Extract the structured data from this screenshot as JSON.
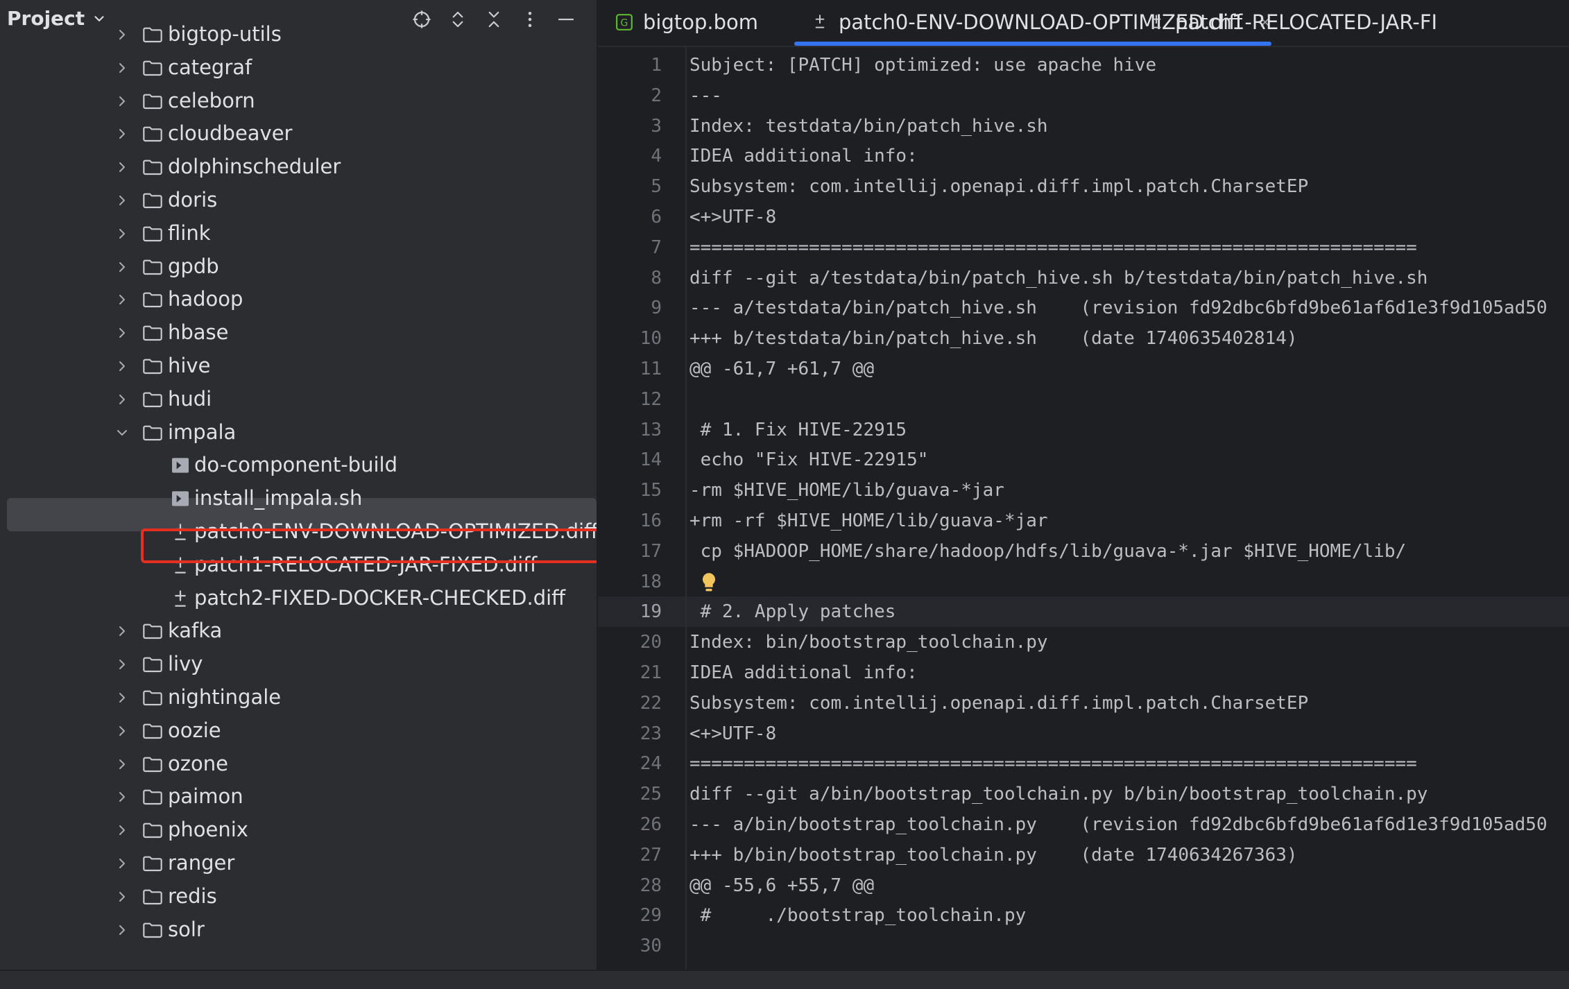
{
  "project_panel": {
    "title": "Project",
    "tree": [
      {
        "label": "bigtop-utils",
        "type": "folder",
        "expanded": false
      },
      {
        "label": "categraf",
        "type": "folder",
        "expanded": false
      },
      {
        "label": "celeborn",
        "type": "folder",
        "expanded": false
      },
      {
        "label": "cloudbeaver",
        "type": "folder",
        "expanded": false
      },
      {
        "label": "dolphinscheduler",
        "type": "folder",
        "expanded": false
      },
      {
        "label": "doris",
        "type": "folder",
        "expanded": false
      },
      {
        "label": "flink",
        "type": "folder",
        "expanded": false
      },
      {
        "label": "gpdb",
        "type": "folder",
        "expanded": false
      },
      {
        "label": "hadoop",
        "type": "folder",
        "expanded": false
      },
      {
        "label": "hbase",
        "type": "folder",
        "expanded": false
      },
      {
        "label": "hive",
        "type": "folder",
        "expanded": false
      },
      {
        "label": "hudi",
        "type": "folder",
        "expanded": false
      },
      {
        "label": "impala",
        "type": "folder",
        "expanded": true
      },
      {
        "label": "do-component-build",
        "type": "script"
      },
      {
        "label": "install_impala.sh",
        "type": "script"
      },
      {
        "label": "patch0-ENV-DOWNLOAD-OPTIMIZED.diff",
        "type": "diff",
        "selected": true
      },
      {
        "label": "patch1-RELOCATED-JAR-FIXED.diff",
        "type": "diff"
      },
      {
        "label": "patch2-FIXED-DOCKER-CHECKED.diff",
        "type": "diff"
      },
      {
        "label": "kafka",
        "type": "folder",
        "expanded": false
      },
      {
        "label": "livy",
        "type": "folder",
        "expanded": false
      },
      {
        "label": "nightingale",
        "type": "folder",
        "expanded": false
      },
      {
        "label": "oozie",
        "type": "folder",
        "expanded": false
      },
      {
        "label": "ozone",
        "type": "folder",
        "expanded": false
      },
      {
        "label": "paimon",
        "type": "folder",
        "expanded": false
      },
      {
        "label": "phoenix",
        "type": "folder",
        "expanded": false
      },
      {
        "label": "ranger",
        "type": "folder",
        "expanded": false
      },
      {
        "label": "redis",
        "type": "folder",
        "expanded": false
      },
      {
        "label": "solr",
        "type": "folder",
        "expanded": false
      }
    ]
  },
  "tabs": [
    {
      "label": "bigtop.bom",
      "icon": "gradle-file-icon"
    },
    {
      "label": "patch0-ENV-DOWNLOAD-OPTIMIZED.diff",
      "icon": "diff-file-icon",
      "active": true
    },
    {
      "label": "patch1-RELOCATED-JAR-FI",
      "icon": "diff-file-icon"
    }
  ],
  "editor": {
    "current_line": 19,
    "lines": [
      {
        "n": "1",
        "text": "Subject: [PATCH] optimized: use apache hive"
      },
      {
        "n": "2",
        "text": "---"
      },
      {
        "n": "3",
        "text": "Index: testdata/bin/patch_hive.sh"
      },
      {
        "n": "4",
        "text": "IDEA additional info:"
      },
      {
        "n": "5",
        "text": "Subsystem: com.intellij.openapi.diff.impl.patch.CharsetEP"
      },
      {
        "n": "6",
        "text": "<+>UTF-8"
      },
      {
        "n": "7",
        "text": "==================================================================="
      },
      {
        "n": "8",
        "text": "diff --git a/testdata/bin/patch_hive.sh b/testdata/bin/patch_hive.sh"
      },
      {
        "n": "9",
        "text": "--- a/testdata/bin/patch_hive.sh    (revision fd92dbc6bfd9be61af6d1e3f9d105ad50"
      },
      {
        "n": "10",
        "text": "+++ b/testdata/bin/patch_hive.sh    (date 1740635402814)"
      },
      {
        "n": "11",
        "text": "@@ -61,7 +61,7 @@"
      },
      {
        "n": "12",
        "text": ""
      },
      {
        "n": "13",
        "text": " # 1. Fix HIVE-22915"
      },
      {
        "n": "14",
        "text": " echo \"Fix HIVE-22915\""
      },
      {
        "n": "15",
        "text": "-rm $HIVE_HOME/lib/guava-*jar"
      },
      {
        "n": "16",
        "text": "+rm -rf $HIVE_HOME/lib/guava-*jar"
      },
      {
        "n": "17",
        "text": " cp $HADOOP_HOME/share/hadoop/hdfs/lib/guava-*.jar $HIVE_HOME/lib/"
      },
      {
        "n": "18",
        "text": ""
      },
      {
        "n": "19",
        "text": " # 2. Apply patches"
      },
      {
        "n": "20",
        "text": "Index: bin/bootstrap_toolchain.py"
      },
      {
        "n": "21",
        "text": "IDEA additional info:"
      },
      {
        "n": "22",
        "text": "Subsystem: com.intellij.openapi.diff.impl.patch.CharsetEP"
      },
      {
        "n": "23",
        "text": "<+>UTF-8"
      },
      {
        "n": "24",
        "text": "==================================================================="
      },
      {
        "n": "25",
        "text": "diff --git a/bin/bootstrap_toolchain.py b/bin/bootstrap_toolchain.py"
      },
      {
        "n": "26",
        "text": "--- a/bin/bootstrap_toolchain.py    (revision fd92dbc6bfd9be61af6d1e3f9d105ad50"
      },
      {
        "n": "27",
        "text": "+++ b/bin/bootstrap_toolchain.py    (date 1740634267363)"
      },
      {
        "n": "28",
        "text": "@@ -55,6 +55,7 @@"
      },
      {
        "n": "29",
        "text": " #     ./bootstrap_toolchain.py"
      },
      {
        "n": "30",
        "text": ""
      }
    ]
  },
  "colors": {
    "accent": "#3574f0",
    "highlight_box": "#e5301f",
    "panel_bg": "#2b2d30",
    "editor_bg": "#1e1f22"
  },
  "icons": [
    "target-icon",
    "expand-collapse-icon",
    "collapse-all-icon",
    "more-options-icon",
    "minimize-icon",
    "chevron-down-icon",
    "chevron-right-icon",
    "folder-icon",
    "script-file-icon",
    "diff-file-icon",
    "gradle-file-icon",
    "close-icon",
    "lightbulb-icon"
  ]
}
